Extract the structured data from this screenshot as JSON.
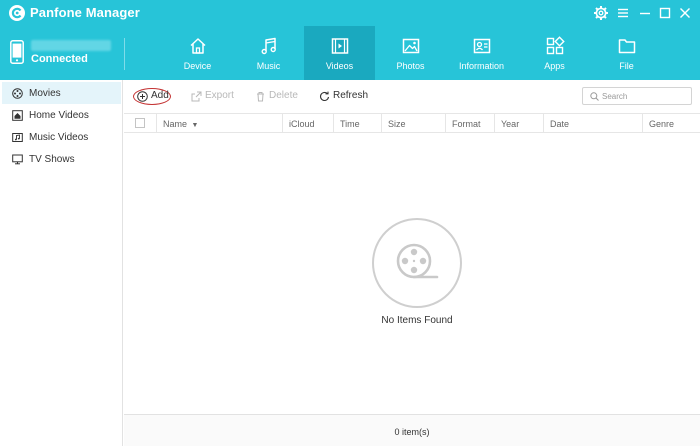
{
  "app": {
    "title": "Panfone Manager"
  },
  "device": {
    "status": "Connected"
  },
  "nav": {
    "tabs": [
      {
        "label": "Device",
        "icon": "home-icon"
      },
      {
        "label": "Music",
        "icon": "music-note-icon"
      },
      {
        "label": "Videos",
        "icon": "film-icon",
        "active": true
      },
      {
        "label": "Photos",
        "icon": "image-icon"
      },
      {
        "label": "Information",
        "icon": "contact-card-icon"
      },
      {
        "label": "Apps",
        "icon": "apps-grid-icon"
      },
      {
        "label": "File",
        "icon": "folder-icon"
      }
    ]
  },
  "sidebar": {
    "items": [
      {
        "label": "Movies",
        "icon": "film-reel-icon",
        "active": true
      },
      {
        "label": "Home Videos",
        "icon": "home-video-icon"
      },
      {
        "label": "Music Videos",
        "icon": "music-video-icon"
      },
      {
        "label": "TV Shows",
        "icon": "tv-icon"
      }
    ]
  },
  "toolbar": {
    "add": "Add",
    "export": "Export",
    "delete": "Delete",
    "refresh": "Refresh",
    "search_placeholder": "Search"
  },
  "table": {
    "columns": [
      "Name",
      "iCloud",
      "Time",
      "Size",
      "Format",
      "Year",
      "Date",
      "Genre"
    ]
  },
  "empty_state": {
    "text": "No Items Found"
  },
  "footer": {
    "count": "0 item(s)"
  },
  "colors": {
    "accent": "#27c4d8",
    "active_tab": "#1aa9bf",
    "highlight": "#c43333"
  }
}
